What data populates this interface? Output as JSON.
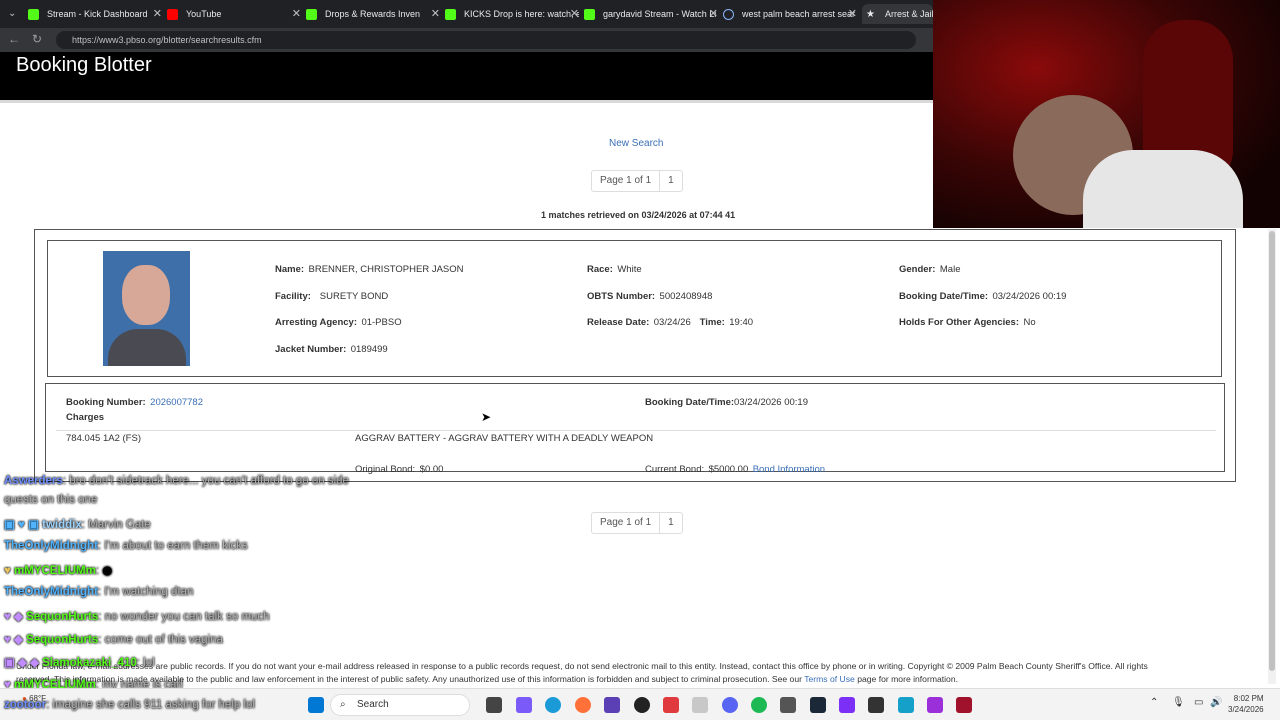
{
  "browser": {
    "tabs": [
      {
        "label": "Stream - Kick Dashboard",
        "color": "#53fc18"
      },
      {
        "label": "YouTube",
        "color": "#ff0000"
      },
      {
        "label": "Drops & Rewards Inven",
        "color": "#53fc18"
      },
      {
        "label": "KICKS Drop is here: watch, e",
        "color": "#53fc18"
      },
      {
        "label": "garydavid Stream - Watch Li",
        "color": "#53fc18"
      },
      {
        "label": "west palm beach arrest sear",
        "color": "#8ab4f8"
      },
      {
        "label": "Arrest & Jail - F",
        "color": "#e8eaed"
      }
    ],
    "url": "https://www3.pbso.org/blotter/searchresults.cfm"
  },
  "page": {
    "title": "Booking Blotter",
    "new_search": "New Search",
    "pager": {
      "label": "Page 1 of 1",
      "page": "1"
    },
    "matches": "1 matches retrieved on 03/24/2026 at 07:44 41",
    "inmate": {
      "name_label": "Name:",
      "name": "BRENNER, CHRISTOPHER JASON",
      "facility_label": "Facility:",
      "facility": "SURETY BOND",
      "agency_label": "Arresting Agency:",
      "agency": "01-PBSO",
      "jacket_label": "Jacket Number:",
      "jacket": "0189499",
      "race_label": "Race:",
      "race": "White",
      "obts_label": "OBTS Number:",
      "obts": "5002408948",
      "release_label": "Release Date:",
      "release_date": "03/24/26",
      "time_label": "Time:",
      "release_time": "19:40",
      "gender_label": "Gender:",
      "gender": "Male",
      "booking_dt_label": "Booking Date/Time:",
      "booking_dt": "03/24/2026 00:19",
      "holds_label": "Holds For Other Agencies:",
      "holds": "No"
    },
    "booking": {
      "number_label": "Booking Number:",
      "number": "2026007782",
      "dt_label": "Booking Date/Time:",
      "dt": "03/24/2026 00:19",
      "charges_label": "Charges",
      "statute": "784.045 1A2 (FS)",
      "charge": "AGGRAV BATTERY - AGGRAV BATTERY WITH A DEADLY WEAPON",
      "orig_bond_label": "Original Bond:",
      "orig_bond": "$0.00",
      "cur_bond_label": "Current Bond:",
      "cur_bond": "$5000.00",
      "bond_info": "Bond Information"
    },
    "footer": {
      "text1": "Under Florida law, e-mail addresses are public records. If you do not want your e-mail address released in response to a public records request, do not send electronic mail to this entity. Instead, contact this office by phone or in writing. Copyright © 2009 Palm Beach County Sheriff's Office. All rights",
      "text2": "reserved. This information is made available to the public and law enforcement in the interest of public safety. Any unauthorized use of this information is forbidden and subject to criminal prosecution. See our",
      "terms": "Terms of Use",
      "text3": "page for more information."
    }
  },
  "chat": [
    {
      "user": "Aswerders",
      "color": "#6f8fff",
      "msg": ": bro don't sidetrack here... you can't afford to go on side"
    },
    {
      "user": "",
      "color": "#b0b0b0",
      "msg": "quests on this one"
    },
    {
      "user": "twiddix",
      "color": "#9bd3ff",
      "msg": ": Marvin Gate"
    },
    {
      "user": "TheOnlyMidnight",
      "color": "#4fb3ff",
      "msg": ": I'm about to earn them kicks"
    },
    {
      "user": "mMYCELIUMm",
      "color": "#53fc18",
      "msg": ":"
    },
    {
      "user": "TheOnlyMidnight",
      "color": "#4fb3ff",
      "msg": ": I'm watching dtan"
    },
    {
      "user": "SequonHurts",
      "color": "#53fc18",
      "msg": ": no wonder you can talk so much"
    },
    {
      "user": "SequonHurts",
      "color": "#53fc18",
      "msg": ": come out of this vagina"
    },
    {
      "user": "Slamokazaki_410",
      "color": "#53fc18",
      "msg": ": lol"
    },
    {
      "user": "mMYCELIUMm",
      "color": "#53fc18",
      "msg": ": my name is carl"
    },
    {
      "user": "zootoor",
      "color": "#6f8fff",
      "msg": ": imagine she calls 911 asking for help lol"
    }
  ],
  "taskbar": {
    "search": "Search",
    "weather": "68°F",
    "time": "8:02 PM",
    "date": "3/24/2026"
  }
}
